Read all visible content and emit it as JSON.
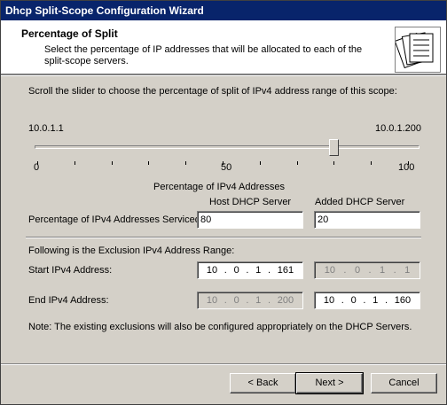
{
  "window": {
    "title": "Dhcp Split-Scope Configuration Wizard"
  },
  "header": {
    "title": "Percentage of Split",
    "description": "Select the percentage of IP addresses that will be allocated to each of the split-scope servers.",
    "icon": "folders-icon"
  },
  "content": {
    "instruction": "Scroll the slider to choose the percentage of split of IPv4 address range of this scope:",
    "range_start": "10.0.1.1",
    "range_end": "10.0.1.200",
    "slider": {
      "min_label": "0",
      "mid_label": "50",
      "max_label": "100",
      "value": 80,
      "caption": "Percentage of IPv4 Addresses"
    },
    "columns": {
      "host": "Host DHCP Server",
      "added": "Added DHCP Server"
    },
    "percentage": {
      "label": "Percentage of IPv4 Addresses Serviced:",
      "host_value": "80",
      "added_value": "20"
    },
    "exclusion_heading": "Following is the Exclusion IPv4 Address Range:",
    "start": {
      "label": "Start IPv4 Address:",
      "host": [
        "10",
        "0",
        "1",
        "161"
      ],
      "added": [
        "10",
        "0",
        "1",
        "1"
      ]
    },
    "end": {
      "label": "End IPv4 Address:",
      "host": [
        "10",
        "0",
        "1",
        "200"
      ],
      "added": [
        "10",
        "0",
        "1",
        "160"
      ]
    },
    "note": "Note: The existing exclusions will also be configured appropriately on the DHCP Servers."
  },
  "buttons": {
    "back": "< Back",
    "next": "Next >",
    "cancel": "Cancel"
  }
}
